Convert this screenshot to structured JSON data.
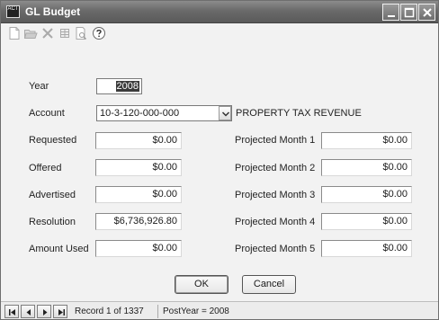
{
  "window": {
    "title": "GL Budget",
    "icon_text": "ACT"
  },
  "toolbar": {
    "icons": [
      "new-icon",
      "open-icon",
      "delete-icon",
      "grid-icon",
      "preview-icon",
      "help-icon"
    ]
  },
  "form": {
    "year": {
      "label": "Year",
      "value": "2008"
    },
    "account": {
      "label": "Account",
      "value": "10-3-120-000-000",
      "description": "PROPERTY TAX REVENUE"
    },
    "left_fields": [
      {
        "label": "Requested",
        "value": "$0.00"
      },
      {
        "label": "Offered",
        "value": "$0.00"
      },
      {
        "label": "Advertised",
        "value": "$0.00"
      },
      {
        "label": "Resolution",
        "value": "$6,736,926.80"
      },
      {
        "label": "Amount Used",
        "value": "$0.00"
      }
    ],
    "right_fields": [
      {
        "label": "Projected Month 1",
        "value": "$0.00"
      },
      {
        "label": "Projected Month 2",
        "value": "$0.00"
      },
      {
        "label": "Projected Month 3",
        "value": "$0.00"
      },
      {
        "label": "Projected Month 4",
        "value": "$0.00"
      },
      {
        "label": "Projected Month 5",
        "value": "$0.00"
      }
    ]
  },
  "buttons": {
    "ok": "OK",
    "cancel": "Cancel"
  },
  "status": {
    "record": "Record 1 of 1337",
    "postyear": "PostYear = 2008"
  },
  "colors": {
    "title_bar": "#6a6a6a",
    "field_bg": "#ffffff",
    "window_bg": "#f2f2f2"
  }
}
